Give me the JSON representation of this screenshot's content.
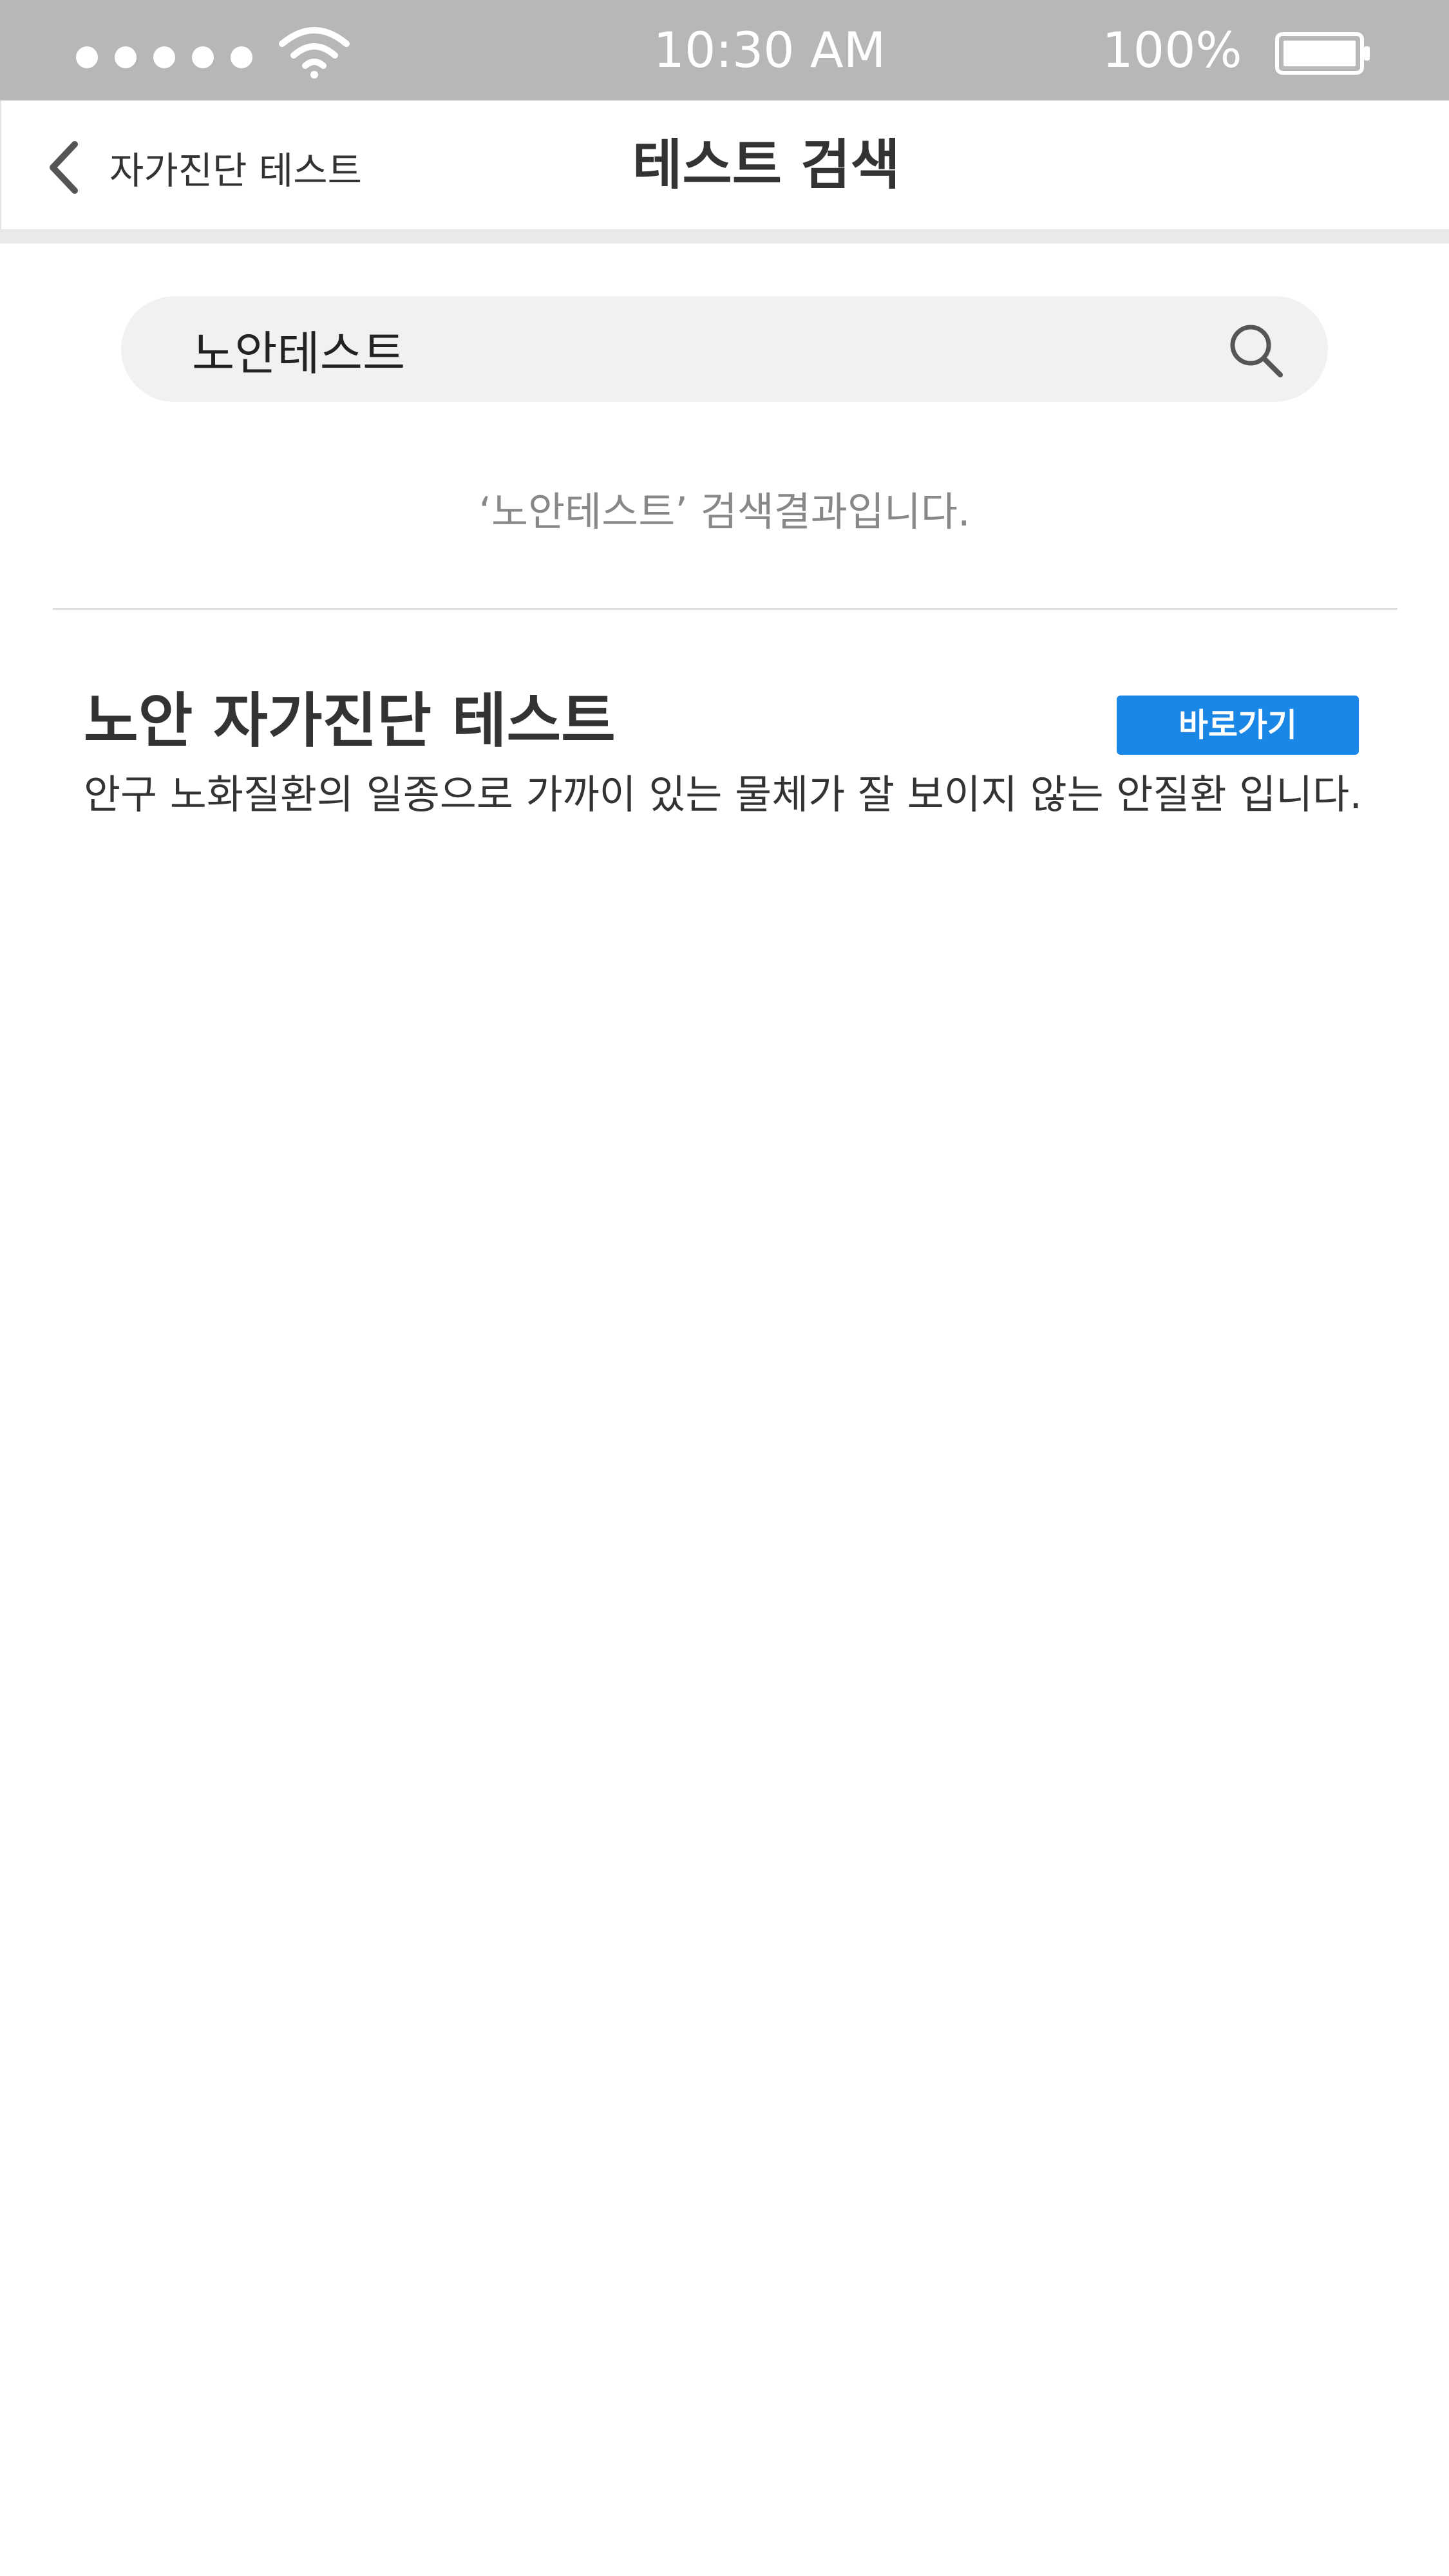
{
  "status_bar": {
    "time": "10:30 AM",
    "battery_percent": "100%",
    "signal_icon": "signal-dots-icon",
    "wifi_icon": "wifi-icon",
    "battery_icon": "battery-icon"
  },
  "nav": {
    "back_label": "자가진단 테스트",
    "back_icon": "chevron-left-icon",
    "title": "테스트 검색"
  },
  "search": {
    "value": "노안테스트",
    "icon": "search-icon"
  },
  "result_caption": "‘노안테스트’ 검색결과입니다.",
  "results": [
    {
      "title": "노안 자가진단 테스트",
      "button_label": "바로가기",
      "description": "안구 노화질환의 일종으로 가까이 있는 물체가 잘 보이지 않는 안질환 입니다."
    }
  ],
  "colors": {
    "status_bar_bg": "#b8b6b8",
    "accent": "#1a86e6",
    "search_bg": "#f1f1f1"
  }
}
